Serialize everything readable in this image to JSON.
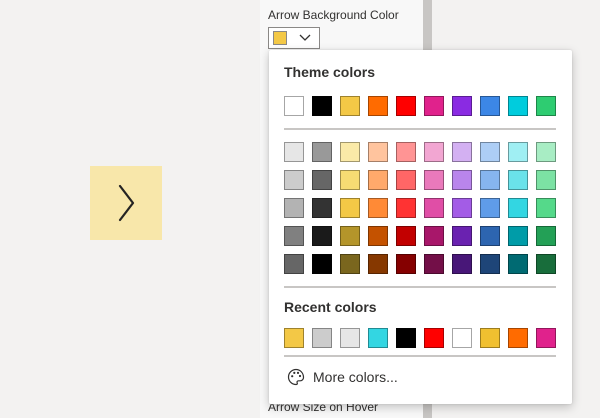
{
  "pane": {
    "arrow_bg_label": "Arrow Background Color",
    "arrow_size_label": "Arrow Size on Hover",
    "selected_color": "#f3c846"
  },
  "flyout": {
    "theme_title": "Theme colors",
    "recent_title": "Recent colors",
    "more_colors_label": "More colors..."
  },
  "theme_colors": [
    "#ffffff",
    "#000000",
    "#f3c846",
    "#ff6b00",
    "#ff0000",
    "#e0228c",
    "#8a2be2",
    "#3c87e6",
    "#00ccdd",
    "#2ecc71"
  ],
  "shade_rows": [
    [
      "#e6e6e6",
      "#999999",
      "#fbeaa8",
      "#ffc49e",
      "#ff9494",
      "#f2a6d2",
      "#d3b0f2",
      "#adcef5",
      "#a0eff3",
      "#a8edc4"
    ],
    [
      "#cccccc",
      "#666666",
      "#f7dc73",
      "#ffa96b",
      "#ff6666",
      "#ea79bb",
      "#b985ec",
      "#86b5ef",
      "#6ae2ea",
      "#7ce2a4"
    ],
    [
      "#b3b3b3",
      "#333333",
      "#f3c846",
      "#ff8a36",
      "#ff3333",
      "#e04ea6",
      "#a35ce6",
      "#5f9ce9",
      "#33d6e2",
      "#55d98a"
    ],
    [
      "#808080",
      "#1a1a1a",
      "#b4952a",
      "#c45200",
      "#c20000",
      "#a8176a",
      "#6a22b0",
      "#2d65b0",
      "#009ca8",
      "#23a056"
    ],
    [
      "#666666",
      "#000000",
      "#7a661e",
      "#863800",
      "#850000",
      "#730f48",
      "#481778",
      "#1e4578",
      "#006a72",
      "#186d3b"
    ]
  ],
  "recent_colors": [
    "#f3c846",
    "#cccccc",
    "#e6e6e6",
    "#33d6e2",
    "#000000",
    "#ff0000",
    "#ffffff",
    "#f0c030",
    "#ff6b00",
    "#e0228c"
  ]
}
